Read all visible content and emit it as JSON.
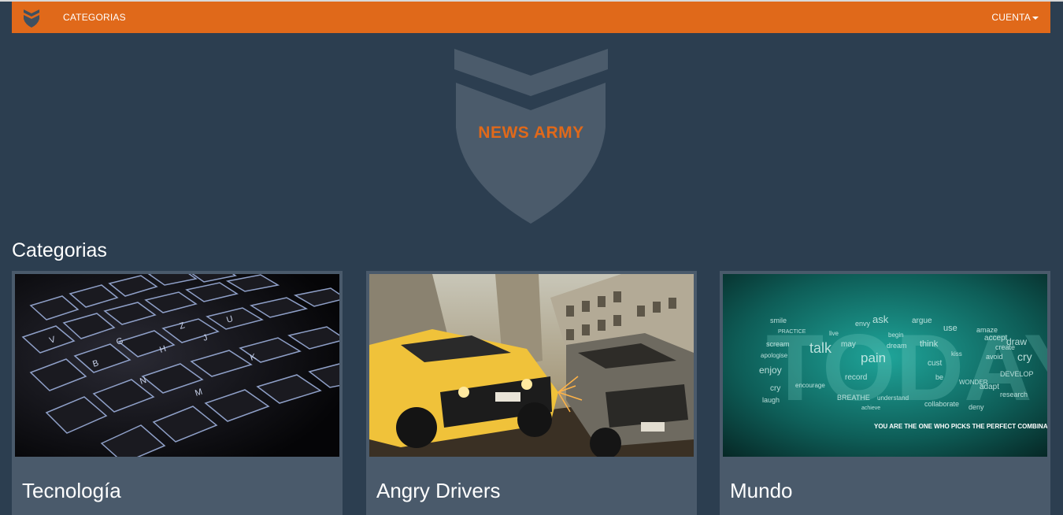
{
  "navbar": {
    "brand_icon": "shield-icon",
    "categorias_label": "CATEGORIAS",
    "cuenta_label": "CUENTA",
    "background": "#e0691a"
  },
  "hero": {
    "logo_text": "NEWS ARMY",
    "logo_icon": "shield-chevron-logo",
    "text_color": "#e0691a"
  },
  "section": {
    "title": "Categorias"
  },
  "categories": [
    {
      "title": "Tecnología",
      "image": "backlit-keyboard-photo"
    },
    {
      "title": "Angry Drivers",
      "image": "racing-cars-crash-image"
    },
    {
      "title": "Mundo",
      "image": "today-word-cloud-image",
      "image_caption": "YOU ARE THE ONE WHO PICKS THE PERFECT COMBINATION."
    }
  ]
}
